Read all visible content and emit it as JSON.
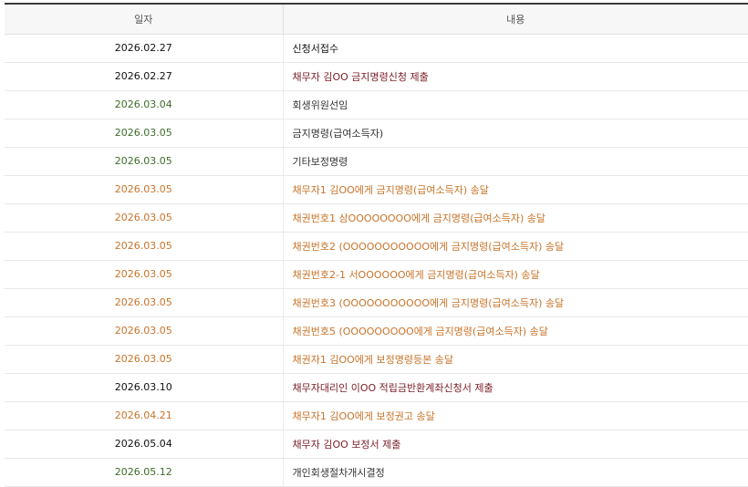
{
  "table": {
    "headers": {
      "date": "일자",
      "content": "내용"
    },
    "rows": [
      {
        "date": "2026.02.27",
        "content": "신청서접수",
        "date_color": "#111111",
        "content_color": "#111111"
      },
      {
        "date": "2026.02.27",
        "content": "채무자 김OO 금지명령신청 제출",
        "date_color": "#111111",
        "content_color": "#7a1c24"
      },
      {
        "date": "2026.03.04",
        "content": "회생위원선임",
        "date_color": "#3d6b28",
        "content_color": "#333333"
      },
      {
        "date": "2026.03.05",
        "content": "금지명령(급여소득자)",
        "date_color": "#3d6b28",
        "content_color": "#333333"
      },
      {
        "date": "2026.03.05",
        "content": "기타보정명령",
        "date_color": "#3d6b28",
        "content_color": "#333333"
      },
      {
        "date": "2026.03.05",
        "content": "채무자1 김OO에게 금지명령(급여소득자) 송달",
        "date_color": "#c8742a",
        "content_color": "#c8742a"
      },
      {
        "date": "2026.03.05",
        "content": "채권번호1 삼OOOOOOOO에게 금지명령(급여소득자) 송달",
        "date_color": "#c8742a",
        "content_color": "#c8742a"
      },
      {
        "date": "2026.03.05",
        "content": "채권번호2 (OOOOOOOOOOO에게 금지명령(급여소득자) 송달",
        "date_color": "#c8742a",
        "content_color": "#c8742a"
      },
      {
        "date": "2026.03.05",
        "content": "채권번호2-1 서OOOOOO에게 금지명령(급여소득자) 송달",
        "date_color": "#c8742a",
        "content_color": "#c8742a"
      },
      {
        "date": "2026.03.05",
        "content": "채권번호3 (OOOOOOOOOOO에게 금지명령(급여소득자) 송달",
        "date_color": "#c8742a",
        "content_color": "#c8742a"
      },
      {
        "date": "2026.03.05",
        "content": "채권번호5 (OOOOOOOOO에게 금지명령(급여소득자) 송달",
        "date_color": "#c8742a",
        "content_color": "#c8742a"
      },
      {
        "date": "2026.03.05",
        "content": "채권자1 김OO에게 보정명령등본 송달",
        "date_color": "#c8742a",
        "content_color": "#c8742a"
      },
      {
        "date": "2026.03.10",
        "content": "채무자대리인 이OO 적립금반환계좌신청서 제출",
        "date_color": "#111111",
        "content_color": "#7a1c24"
      },
      {
        "date": "2026.04.21",
        "content": "채무자1 김OO에게 보정권고 송달",
        "date_color": "#c8742a",
        "content_color": "#c8742a"
      },
      {
        "date": "2026.05.04",
        "content": "채무자 김OO 보정서 제출",
        "date_color": "#111111",
        "content_color": "#7a1c24"
      },
      {
        "date": "2026.05.12",
        "content": "개인회생절차개시결정",
        "date_color": "#3d6b28",
        "content_color": "#333333"
      }
    ]
  }
}
